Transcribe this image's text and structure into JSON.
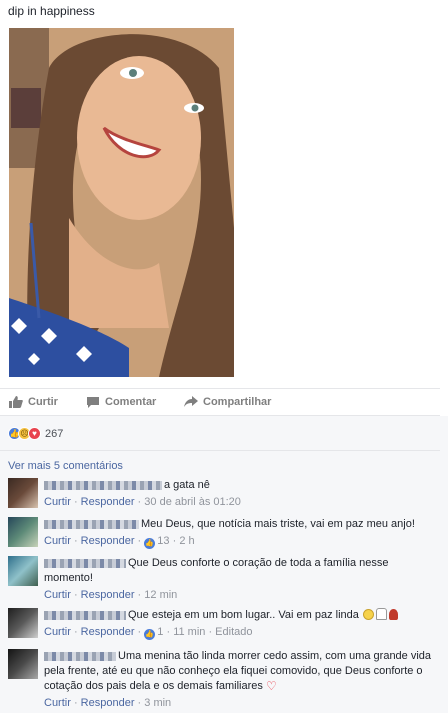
{
  "post": {
    "title": "dip in happiness"
  },
  "actions": {
    "like_label": "Curtir",
    "comment_label": "Comentar",
    "share_label": "Compartilhar"
  },
  "reactions": {
    "count": "267",
    "icons": [
      "like-icon",
      "sad-icon",
      "love-icon"
    ],
    "colors": {
      "like": "#4a7cd9",
      "sad": "#f4c142",
      "love": "#e8434f"
    }
  },
  "more_comments": "Ver mais 5 comentários",
  "comments": [
    {
      "text": "a gata nê",
      "like": "Curtir",
      "reply": "Responder",
      "time": "30 de abril às 01:20"
    },
    {
      "text": "Meu Deus, que notícia mais triste, vai em paz meu anjo!",
      "like": "Curtir",
      "reply": "Responder",
      "likes": "13",
      "time": "2 h"
    },
    {
      "text": "Que Deus conforte o coração de toda a família nesse momento!",
      "like": "Curtir",
      "reply": "Responder",
      "time": "12 min"
    },
    {
      "text": "Que esteja em um bom lugar.. Vai em paz linda",
      "like": "Curtir",
      "reply": "Responder",
      "likes": "1",
      "time": "11 min",
      "edited": "Editado"
    },
    {
      "text": "Uma menina tão linda morrer cedo assim, com uma grande vida pela frente, até eu que não conheço ela fiquei comovido, que Deus conforte o cotação dos pais dela e os demais familiares",
      "like": "Curtir",
      "reply": "Responder",
      "time": "3 min"
    }
  ],
  "colors": {
    "link": "#4b67a1",
    "meta": "#90949c",
    "text": "#1d2129"
  }
}
